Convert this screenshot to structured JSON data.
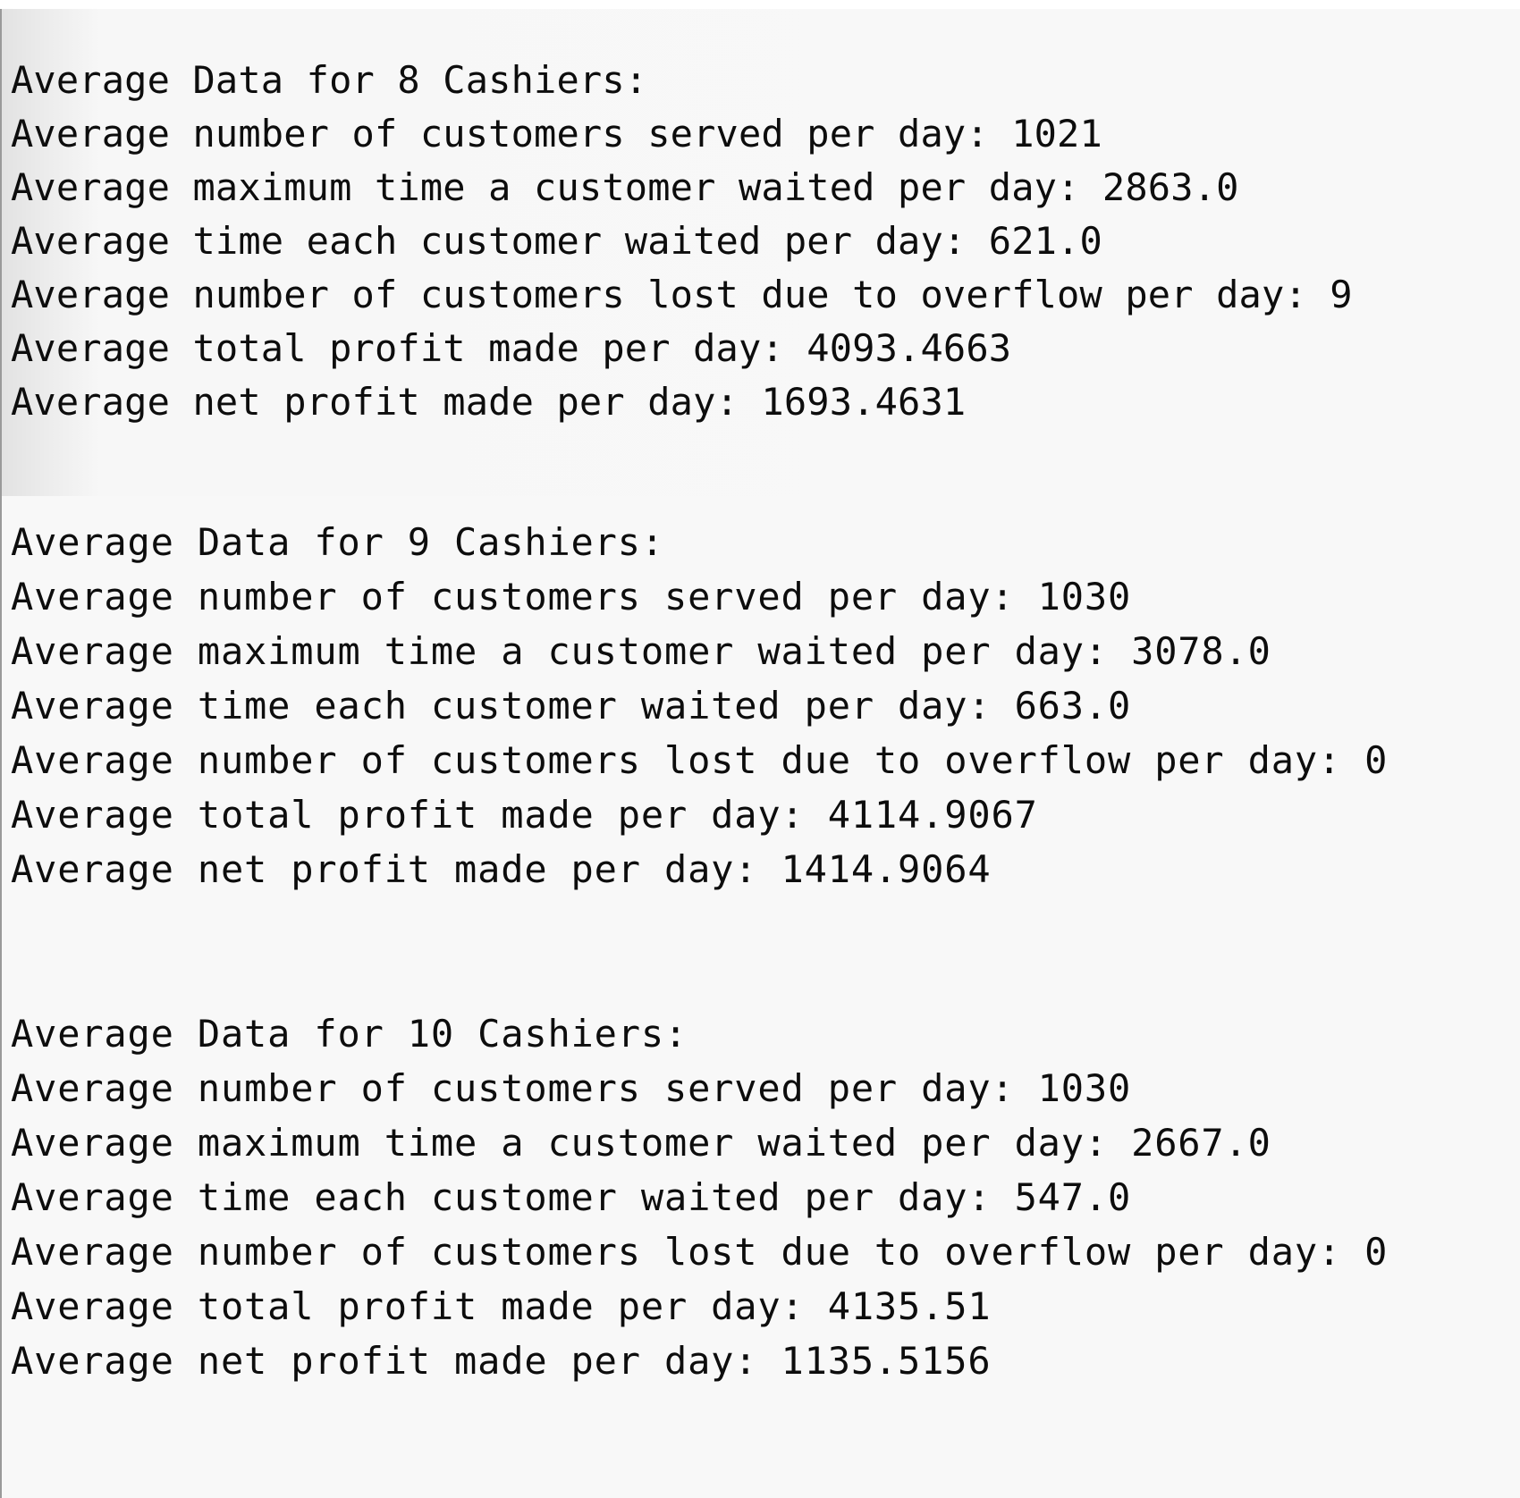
{
  "blocks": [
    {
      "heading": "Average Data for 8 Cashiers:",
      "lines": [
        "Average number of customers served per day: 1021",
        "Average maximum time a customer waited per day: 2863.0",
        "Average time each customer waited per day: 621.0",
        "Average number of customers lost due to overflow per day: 9",
        "Average total profit made per day: 4093.4663",
        "Average net profit made per day: 1693.4631"
      ]
    },
    {
      "heading": "Average Data for 9 Cashiers:",
      "lines": [
        "Average number of customers served per day: 1030",
        "Average maximum time a customer waited per day: 3078.0",
        "Average time each customer waited per day: 663.0",
        "Average number of customers lost due to overflow per day: 0",
        "Average total profit made per day: 4114.9067",
        "Average net profit made per day: 1414.9064"
      ]
    },
    {
      "heading": "Average Data for 10 Cashiers:",
      "lines": [
        "Average number of customers served per day: 1030",
        "Average maximum time a customer waited per day: 2667.0",
        "Average time each customer waited per day: 547.0",
        "Average number of customers lost due to overflow per day: 0",
        "Average total profit made per day: 4135.51",
        "Average net profit made per day: 1135.5156"
      ]
    }
  ]
}
